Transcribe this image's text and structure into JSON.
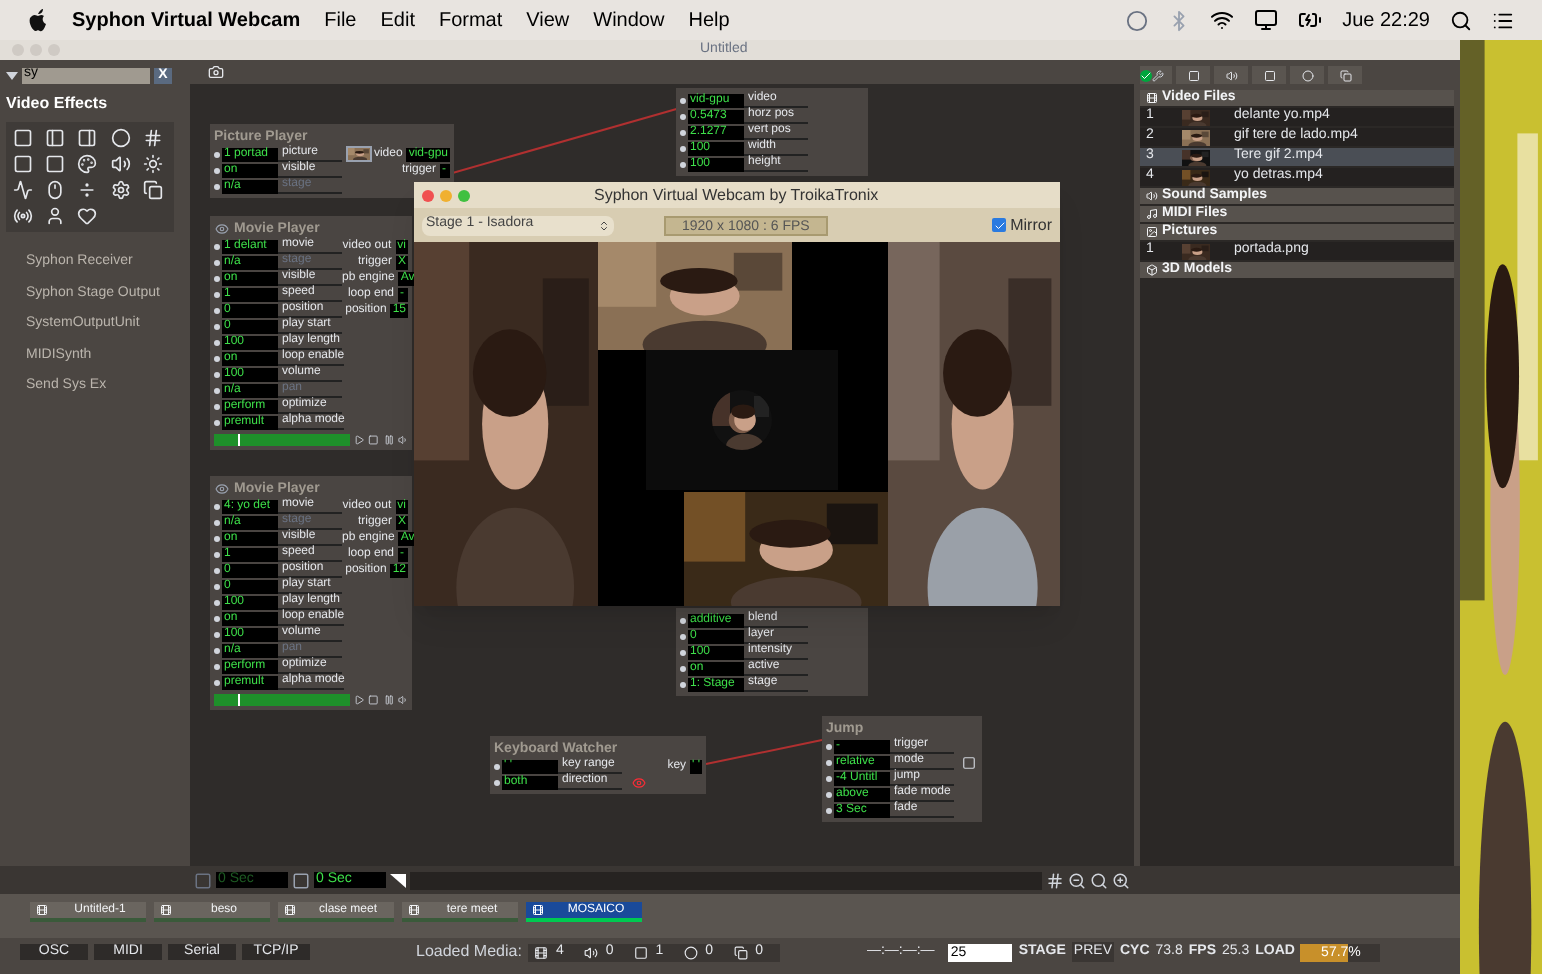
{
  "menu_bar": {
    "app": "Syphon Virtual Webcam",
    "menus": [
      "File",
      "Edit",
      "Format",
      "View",
      "Window",
      "Help"
    ],
    "clock": "Jue 22:29"
  },
  "window": {
    "title": "Untitled"
  },
  "browser": {
    "search": {
      "value": "sy"
    },
    "clear": "X",
    "section": "Video Effects",
    "items": [
      "Syphon Receiver",
      "Syphon Stage Output",
      "SystemOutputUnit",
      "MIDISynth",
      "Send Sys Ex"
    ]
  },
  "actors": [
    {
      "kind": "picture",
      "title": "Picture Player",
      "rows": [
        {
          "in": "1 portad",
          "label": "picture",
          "out_label": "video",
          "out": "vid-gpu",
          "disabled": false
        },
        {
          "in": "on",
          "label": "visible",
          "out_label": "trigger",
          "out": "-",
          "disabled": false
        },
        {
          "in": "n/a",
          "label": "stage",
          "disabled": true
        }
      ]
    },
    {
      "kind": "movie",
      "title": "Movie Player",
      "level": 0.15,
      "rows": [
        {
          "in": "1 delant",
          "label": "movie",
          "out_label": "video out",
          "out": "vi",
          "disabled": false
        },
        {
          "in": "n/a",
          "label": "stage",
          "out_label": "trigger",
          "out": "X",
          "disabled": true
        },
        {
          "in": "on",
          "label": "visible",
          "out_label": "pb engine",
          "out": "Av",
          "disabled": false
        },
        {
          "in": "1",
          "label": "speed",
          "out_label": "loop end",
          "out": "-",
          "disabled": false
        },
        {
          "in": "0",
          "label": "position",
          "out_label": "position",
          "out": "15",
          "disabled": false
        },
        {
          "in": "0",
          "label": "play start",
          "disabled": false
        },
        {
          "in": "100",
          "label": "play length",
          "disabled": false
        },
        {
          "in": "on",
          "label": "loop enable",
          "disabled": false
        },
        {
          "in": "100",
          "label": "volume",
          "disabled": false
        },
        {
          "in": "n/a",
          "label": "pan",
          "disabled": true
        },
        {
          "in": "perform",
          "label": "optimize",
          "disabled": false
        },
        {
          "in": "premult",
          "label": "alpha mode",
          "disabled": false
        }
      ]
    },
    {
      "kind": "movie",
      "title": "Movie Player",
      "level": 0.15,
      "rows": [
        {
          "in": "4: yo det",
          "label": "movie",
          "out_label": "video out",
          "out": "vi",
          "disabled": false
        },
        {
          "in": "n/a",
          "label": "stage",
          "out_label": "trigger",
          "out": "X",
          "disabled": true
        },
        {
          "in": "on",
          "label": "visible",
          "out_label": "pb engine",
          "out": "Av",
          "disabled": false
        },
        {
          "in": "1",
          "label": "speed",
          "out_label": "loop end",
          "out": "-",
          "disabled": false
        },
        {
          "in": "0",
          "label": "position",
          "out_label": "position",
          "out": "12",
          "disabled": false
        },
        {
          "in": "0",
          "label": "play start",
          "disabled": false
        },
        {
          "in": "100",
          "label": "play length",
          "disabled": false
        },
        {
          "in": "on",
          "label": "loop enable",
          "disabled": false
        },
        {
          "in": "100",
          "label": "volume",
          "disabled": false
        },
        {
          "in": "n/a",
          "label": "pan",
          "disabled": true
        },
        {
          "in": "perform",
          "label": "optimize",
          "disabled": false
        },
        {
          "in": "premult",
          "label": "alpha mode",
          "disabled": false
        }
      ]
    },
    {
      "kind": "projector",
      "rows": [
        {
          "in": "vid-gpu",
          "label": "video",
          "disabled": false
        },
        {
          "in": "0.5473",
          "label": "horz pos",
          "disabled": false
        },
        {
          "in": "2.1277",
          "label": "vert pos",
          "disabled": false
        },
        {
          "in": "100",
          "label": "width",
          "disabled": false
        },
        {
          "in": "100",
          "label": "height",
          "disabled": false
        }
      ],
      "lower_rows": [
        {
          "in": "additive",
          "label": "blend",
          "disabled": false
        },
        {
          "in": "0",
          "label": "layer",
          "disabled": false
        },
        {
          "in": "100",
          "label": "intensity",
          "disabled": false
        },
        {
          "in": "on",
          "label": "active",
          "disabled": false
        },
        {
          "in": "1: Stage",
          "label": "stage",
          "disabled": false
        }
      ]
    },
    {
      "kind": "keyboard",
      "title": "Keyboard Watcher",
      "rows": [
        {
          "in": "' '",
          "label": "key range",
          "out_label": "key",
          "out": "' '",
          "disabled": false
        },
        {
          "in": "both",
          "label": "direction",
          "disabled": false
        }
      ]
    },
    {
      "kind": "jump",
      "title": "Jump",
      "rows": [
        {
          "in": "-",
          "label": "trigger",
          "disabled": false
        },
        {
          "in": "relative",
          "label": "mode",
          "disabled": false
        },
        {
          "in": "-4 Untitl",
          "label": "jump",
          "disabled": false
        },
        {
          "in": "above",
          "label": "fade mode",
          "disabled": false
        },
        {
          "in": "3 Sec",
          "label": "fade",
          "disabled": false
        }
      ]
    }
  ],
  "stage_window": {
    "title": "Syphon Virtual Webcam by TroikaTronix",
    "source": "Stage 1 - Isadora",
    "format": "1920 x 1080 : 6 FPS",
    "mirror": {
      "label": "Mirror",
      "checked": true
    }
  },
  "media": {
    "sections": [
      {
        "title": "Video Files",
        "items": [
          {
            "index": "1",
            "name": "delante yo.mp4",
            "selected": false
          },
          {
            "index": "2",
            "name": "gif tere de lado.mp4",
            "selected": false
          },
          {
            "index": "3",
            "name": "Tere gif 2.mp4",
            "selected": true
          },
          {
            "index": "4",
            "name": "yo detras.mp4",
            "selected": false
          }
        ]
      },
      {
        "title": "Sound Samples"
      },
      {
        "title": "MIDI Files"
      },
      {
        "title": "Pictures",
        "items": [
          {
            "index": "1",
            "name": "portada.png",
            "selected": false
          }
        ]
      },
      {
        "title": "3D Models"
      }
    ]
  },
  "timeline": {
    "start": "0 Sec",
    "current": "0 Sec"
  },
  "scenes": [
    {
      "name": "Untitled-1",
      "selected": false
    },
    {
      "name": "beso",
      "selected": false
    },
    {
      "name": "clase meet",
      "selected": false
    },
    {
      "name": "tere meet",
      "selected": false
    },
    {
      "name": "MOSAICO",
      "selected": true
    }
  ],
  "status_bar": {
    "ports": [
      "OSC",
      "MIDI",
      "Serial",
      "TCP/IP"
    ],
    "loaded_label": "Loaded Media:",
    "counts": [
      "4",
      "0",
      "1",
      "0",
      "0"
    ],
    "timecode": "—:—:—:—",
    "fps_field": "25",
    "stage": "STAGE",
    "prev": "PREV",
    "cyc_label": "CYC",
    "cyc": "73.8",
    "fps_label": "FPS",
    "fps": "25.3",
    "load_label": "LOAD",
    "load_meter": {
      "reading": "57.7%",
      "level": 0.577
    }
  }
}
